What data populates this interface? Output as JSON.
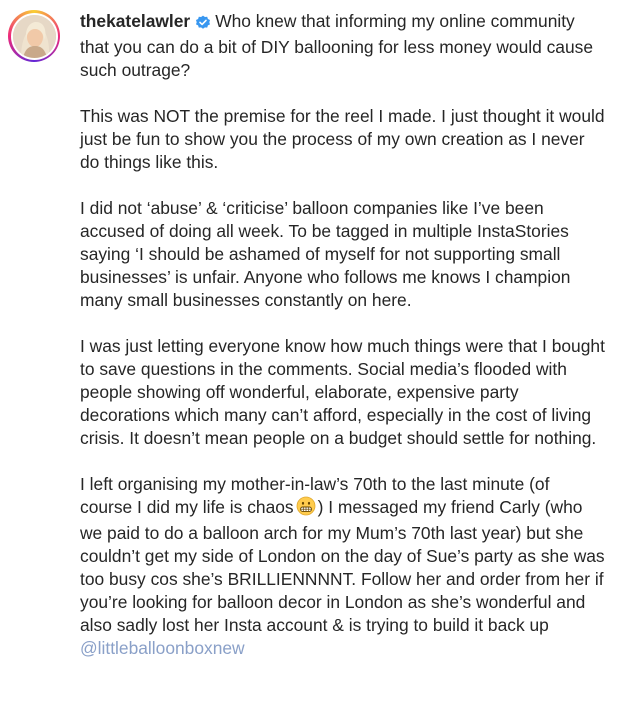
{
  "post": {
    "username": "thekatelawler",
    "verified_icon": "verified-badge-icon",
    "paragraphs": [
      "Who knew that informing my online community that you can do a bit of DIY ballooning for less money would cause such outrage?",
      "This was NOT the premise for the reel I made. I just thought it would just be fun to show you the process of my own creation as I never do things like this.",
      "I did not ‘abuse’ & ‘criticise’ balloon companies like I’ve been accused of doing all week. To be tagged in multiple InstaStories saying ‘I should be ashamed of myself for not supporting small businesses’ is unfair. Anyone who follows me knows I champion many small businesses constantly on here.",
      "I was just letting everyone know how much things were that I bought to save questions in the comments. Social media’s flooded with people showing off wonderful, elaborate, expensive party decorations which many can’t afford, especially in the cost of living crisis. It doesn’t mean people on a budget should settle for nothing."
    ],
    "last_paragraph": {
      "part1": "I left organising my mother-in-law’s 70th to the last minute (of course I did my life is chaos",
      "emoji_icon": "grimacing-face-emoji-icon",
      "part2": ") I messaged my friend Carly (who we paid to do a balloon arch for my Mum’s 70th last year) but she couldn’t get my side of London on the day of Sue’s party as she was too busy cos she’s BRILLIENNNNT. Follow her and order from her if you’re looking for balloon decor in London as she’s wonderful and also sadly lost her Insta account & is trying to build it back up",
      "mention": "@littleballoonboxnew"
    }
  },
  "colors": {
    "text": "#262626",
    "verified": "#3897f0",
    "mention": "#8aa0c8"
  }
}
